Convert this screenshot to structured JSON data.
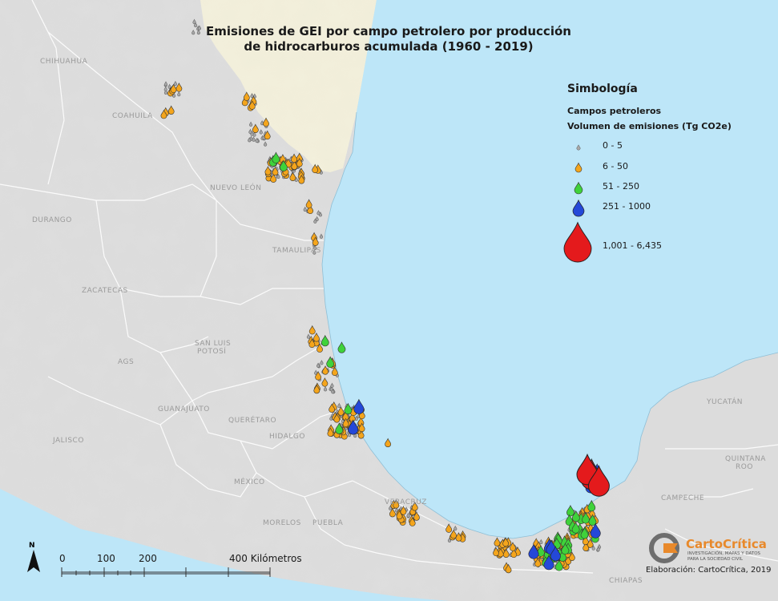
{
  "title": {
    "line1": "Emisiones de GEI por campo petrolero por producción",
    "line2": "de hidrocarburos acumulada (1960 - 2019)"
  },
  "legend": {
    "heading": "Simbología",
    "subtitle": "Campos petroleros",
    "volume_title": "Volumen de emisiones (Tg CO2e)",
    "classes": [
      {
        "label": "0 - 5",
        "color": "#a9a9a9",
        "symbol": "drop-small-gray-icon"
      },
      {
        "label": "6 - 50",
        "color": "#f4a51c",
        "symbol": "drop-orange-icon"
      },
      {
        "label": "51 - 250",
        "color": "#3fd23a",
        "symbol": "drop-green-icon"
      },
      {
        "label": "251 - 1000",
        "color": "#2448d8",
        "symbol": "drop-blue-icon"
      },
      {
        "label": "1,001 - 6,435",
        "color": "#e41a1c",
        "symbol": "drop-red-icon"
      }
    ]
  },
  "colors": {
    "sea": "#bde6f8",
    "land": "#dedede",
    "usa": "#f3f0dc",
    "borders": "#ffffff"
  },
  "place_labels": [
    {
      "text": "CHIHUAHUA"
    },
    {
      "text": "COAHUILA"
    },
    {
      "text": "NUEVO LEÓN"
    },
    {
      "text": "DURANGO"
    },
    {
      "text": "TAMAULIPAS"
    },
    {
      "text": "ZACATECAS"
    },
    {
      "text": "SAN LUIS"
    },
    {
      "text": "POTOSÍ"
    },
    {
      "text": "AGS"
    },
    {
      "text": "GUANAJUATO"
    },
    {
      "text": "QUERÉTARO"
    },
    {
      "text": "HIDALGO"
    },
    {
      "text": "JALISCO"
    },
    {
      "text": "MÉXICO"
    },
    {
      "text": "MORELOS"
    },
    {
      "text": "PUEBLA"
    },
    {
      "text": "VERACRUZ"
    },
    {
      "text": "YUCATÁN"
    },
    {
      "text": "QUINTANA"
    },
    {
      "text": "ROO"
    },
    {
      "text": "CAMPECHE"
    },
    {
      "text": "CHIAPAS"
    }
  ],
  "scale_bar": {
    "north": "N",
    "ticks": [
      "0",
      "100",
      "200",
      "400 Kilómetros"
    ]
  },
  "credit": "Elaboración: CartoCrítica, 2019",
  "logo": {
    "name": "CartoCrítica",
    "tagline1": "INVESTIGACIÓN, MAPAS Y DATOS",
    "tagline2": "PARA LA SOCIEDAD CIVIL"
  }
}
